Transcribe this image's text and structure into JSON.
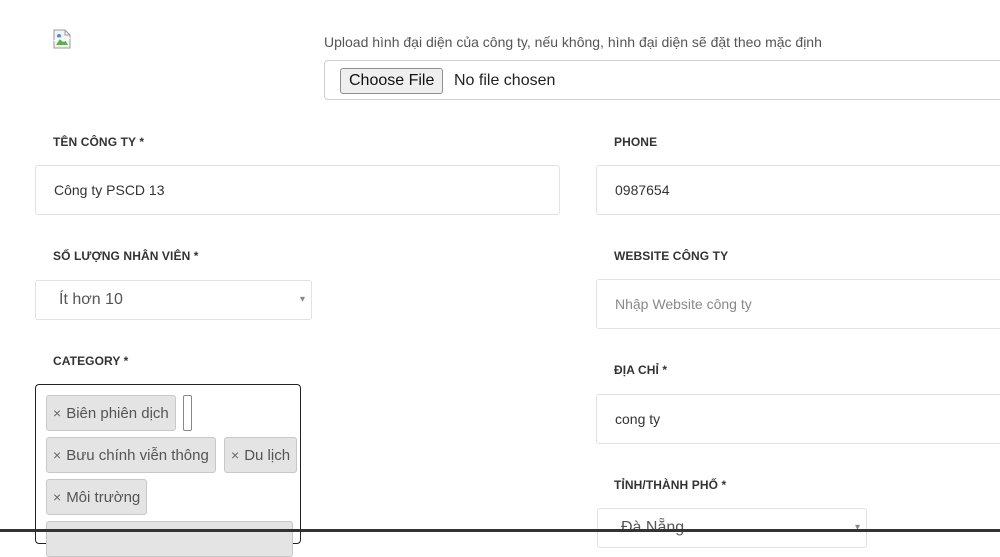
{
  "upload": {
    "hint": "Upload hình đại diện của công ty, nếu không, hình đại diện sẽ đặt theo mặc định",
    "button_label": "Choose File",
    "status": "No file chosen"
  },
  "fields": {
    "company_name": {
      "label": "TÊN CÔNG TY *",
      "value": "Công ty PSCD 13"
    },
    "phone": {
      "label": "PHONE",
      "value": "0987654"
    },
    "employees": {
      "label": "SỐ LƯỢNG NHÂN VIÊN *",
      "value": "Ít hơn 10"
    },
    "website": {
      "label": "WEBSITE CÔNG TY",
      "placeholder": "Nhập Website công ty"
    },
    "category": {
      "label": "CATEGORY *",
      "tags": [
        "Biên phiên dịch",
        "Bưu chính viễn thông",
        "Du lịch",
        "Môi trường"
      ],
      "remove_symbol": "×"
    },
    "address": {
      "label": "ĐỊA CHỈ *",
      "value": "cong ty"
    },
    "city": {
      "label": "TỈNH/THÀNH PHỐ *",
      "value": "Đà Nẵng"
    }
  },
  "icons": {
    "broken_image": "broken-image-icon",
    "select_caret": "▾"
  }
}
